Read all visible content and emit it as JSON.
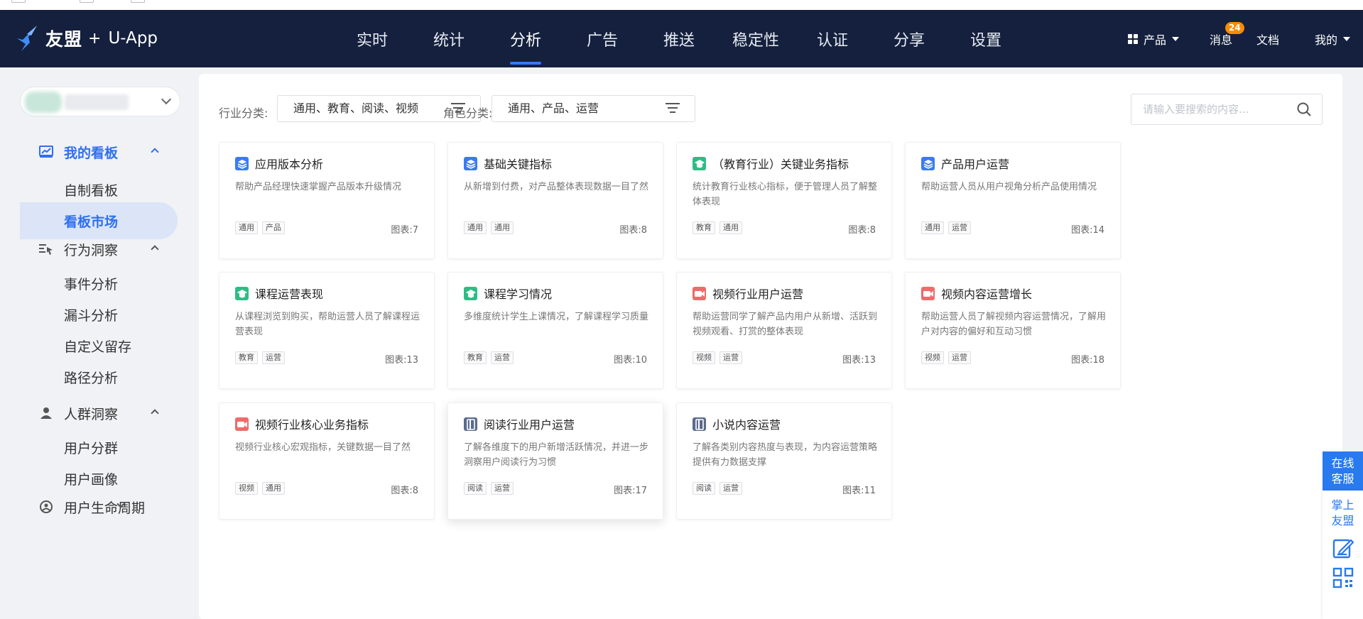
{
  "brand": {
    "name": "友盟",
    "plus": "+",
    "product": "U-App"
  },
  "nav": {
    "items": [
      {
        "label": "实时",
        "active": false
      },
      {
        "label": "统计",
        "active": false
      },
      {
        "label": "分析",
        "active": true
      },
      {
        "label": "广告",
        "active": false
      },
      {
        "label": "推送",
        "active": false
      },
      {
        "label": "稳定性",
        "active": false
      },
      {
        "label": "认证",
        "active": false
      },
      {
        "label": "分享",
        "active": false
      },
      {
        "label": "设置",
        "active": false
      }
    ],
    "product_label": "产品",
    "messages_label": "消息",
    "messages_badge": "24",
    "docs_label": "文档",
    "mine_label": "我的"
  },
  "sidebar": {
    "groups": [
      {
        "label": "我的看板",
        "icon": "chart-icon",
        "items": [
          "自制看板",
          "看板市场"
        ]
      },
      {
        "label": "行为洞察",
        "icon": "cursor-list-icon",
        "items": [
          "事件分析",
          "漏斗分析",
          "自定义留存",
          "路径分析"
        ]
      },
      {
        "label": "人群洞察",
        "icon": "user-icon",
        "items": [
          "用户分群",
          "用户画像"
        ]
      },
      {
        "label": "用户生命周期",
        "icon": "lifecycle-icon",
        "items": []
      }
    ],
    "active_item": "看板市场"
  },
  "filters": {
    "industry_label": "行业分类:",
    "industry_value": "通用、教育、阅读、视频",
    "role_label": "角色分类:",
    "role_value": "通用、产品、运营",
    "search_placeholder": "请输入要搜索的内容..."
  },
  "count_prefix": "图表:",
  "cards": [
    {
      "title": "应用版本分析",
      "desc": "帮助产品经理快速掌握产品版本升级情况",
      "tags": [
        "通用",
        "产品"
      ],
      "count": "7",
      "icon": "layers-icon",
      "icon_color": "#3a7bf0"
    },
    {
      "title": "基础关键指标",
      "desc": "从新增到付费，对产品整体表现数据一目了然",
      "tags": [
        "通用",
        "通用"
      ],
      "count": "8",
      "icon": "layers-icon",
      "icon_color": "#3a7bf0"
    },
    {
      "title": "（教育行业）关键业务指标",
      "desc": "统计教育行业核心指标，便于管理人员了解整体表现",
      "tags": [
        "教育",
        "通用"
      ],
      "count": "8",
      "icon": "graduation-cap-icon",
      "icon_color": "#2dbd84"
    },
    {
      "title": "产品用户运营",
      "desc": "帮助运营人员从用户视角分析产品使用情况",
      "tags": [
        "通用",
        "运营"
      ],
      "count": "14",
      "icon": "layers-icon",
      "icon_color": "#3a7bf0"
    },
    {
      "title": "课程运营表现",
      "desc": "从课程浏览到购买，帮助运营人员了解课程运营表现",
      "tags": [
        "教育",
        "运营"
      ],
      "count": "13",
      "icon": "graduation-cap-icon",
      "icon_color": "#2dbd84"
    },
    {
      "title": "课程学习情况",
      "desc": "多维度统计学生上课情况，了解课程学习质量",
      "tags": [
        "教育",
        "运营"
      ],
      "count": "10",
      "icon": "graduation-cap-icon",
      "icon_color": "#2dbd84"
    },
    {
      "title": "视频行业用户运营",
      "desc": "帮助运营同学了解产品内用户从新增、活跃到视频观看、打赏的整体表现",
      "tags": [
        "视频",
        "运营"
      ],
      "count": "13",
      "icon": "video-camera-icon",
      "icon_color": "#ef6a6a"
    },
    {
      "title": "视频内容运营增长",
      "desc": "帮助运营人员了解视频内容运营情况，了解用户对内容的偏好和互动习惯",
      "tags": [
        "视频",
        "运营"
      ],
      "count": "18",
      "icon": "video-camera-icon",
      "icon_color": "#ef6a6a"
    },
    {
      "title": "视频行业核心业务指标",
      "desc": "视频行业核心宏观指标，关键数据一目了然",
      "tags": [
        "视频",
        "通用"
      ],
      "count": "8",
      "icon": "video-camera-icon",
      "icon_color": "#ef6a6a"
    },
    {
      "title": "阅读行业用户运营",
      "desc": "了解各维度下的用户新增活跃情况，并进一步洞察用户阅读行为习惯",
      "tags": [
        "阅读",
        "运营"
      ],
      "count": "17",
      "icon": "book-icon",
      "icon_color": "#5b6b8f"
    },
    {
      "title": "小说内容运营",
      "desc": "了解各类别内容热度与表现，为内容运营策略提供有力数据支撑",
      "tags": [
        "阅读",
        "运营"
      ],
      "count": "11",
      "icon": "book-icon",
      "icon_color": "#5b6b8f"
    }
  ],
  "float_service": {
    "online_label": "在线客服",
    "umeng_label": "掌上友盟",
    "feedback_icon": "edit-icon",
    "qr_icon": "qr-code-icon"
  }
}
